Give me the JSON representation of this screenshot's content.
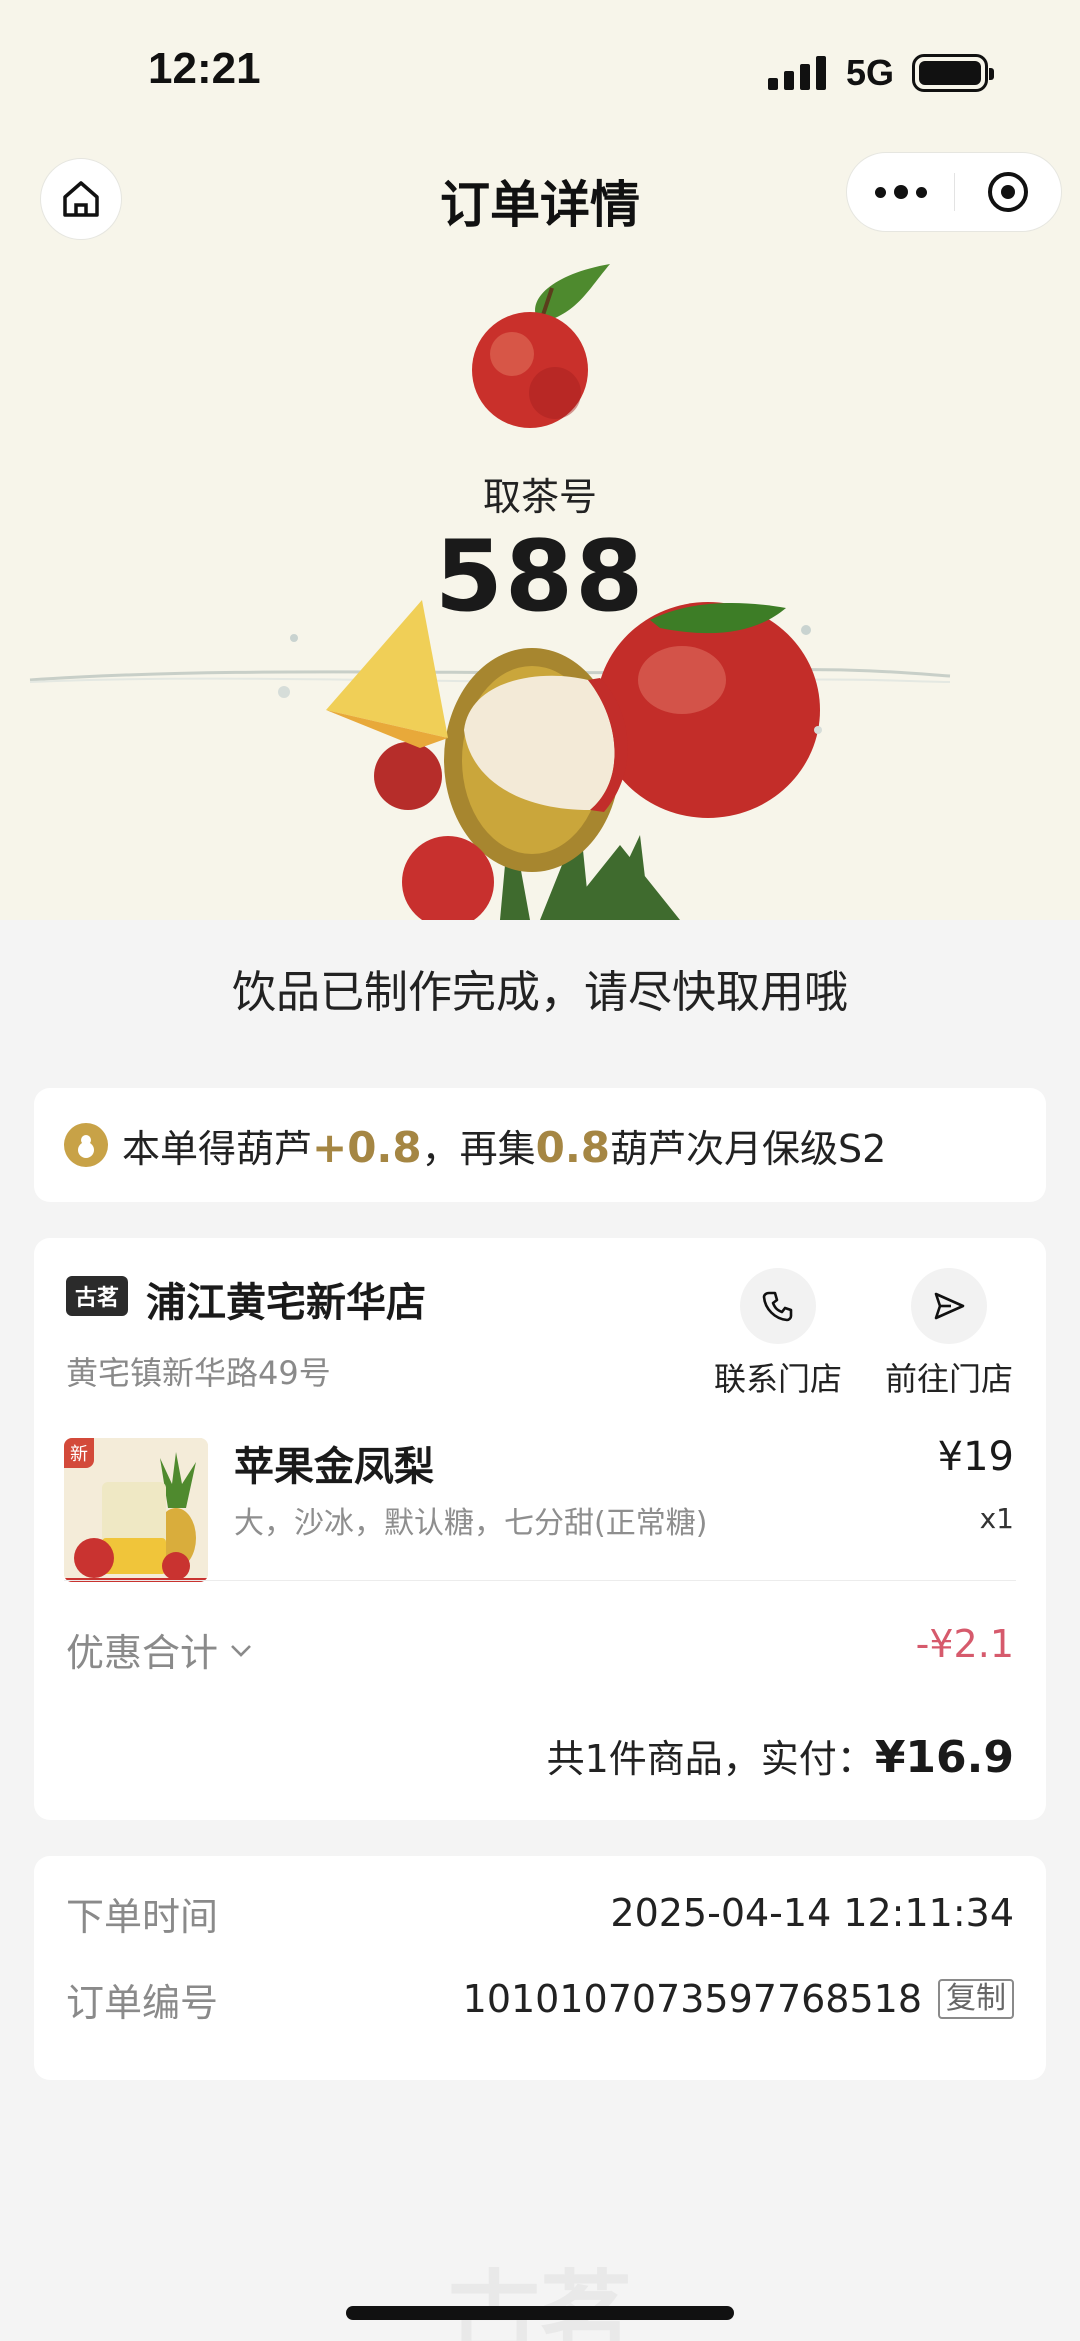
{
  "status_bar": {
    "time": "12:21",
    "network": "5G"
  },
  "nav": {
    "title": "订单详情"
  },
  "pickup": {
    "label": "取茶号",
    "number": "588"
  },
  "status_message": "饮品已制作完成，请尽快取用哦",
  "points": {
    "prefix": "本单得葫芦",
    "earned": "+0.8",
    "middle": "，再集",
    "needed": "0.8",
    "suffix": "葫芦次月保级S2"
  },
  "store": {
    "badge": "古茗",
    "name": "浦江黄宅新华店",
    "address": "黄宅镇新华路49号",
    "contact_label": "联系门店",
    "goto_label": "前往门店"
  },
  "product": {
    "tag": "新",
    "name": "苹果金凤梨",
    "spec": "大，沙冰，默认糖，七分甜(正常糖)",
    "price": "¥19",
    "qty": "x1"
  },
  "discount": {
    "label": "优惠合计",
    "value": "-¥2.1"
  },
  "total": {
    "text": "共1件商品，实付：",
    "amount": "¥16.9"
  },
  "order_info": {
    "time_label": "下单时间",
    "time_value": "2025-04-14 12:11:34",
    "number_label": "订单编号",
    "number_value": "1010107073597768518",
    "copy_label": "复制"
  },
  "footer": {
    "logo": "古茗"
  },
  "colors": {
    "accent_gold": "#a58643",
    "discount_red": "#d65a6c",
    "hero_bg": "#f7f5ea"
  }
}
